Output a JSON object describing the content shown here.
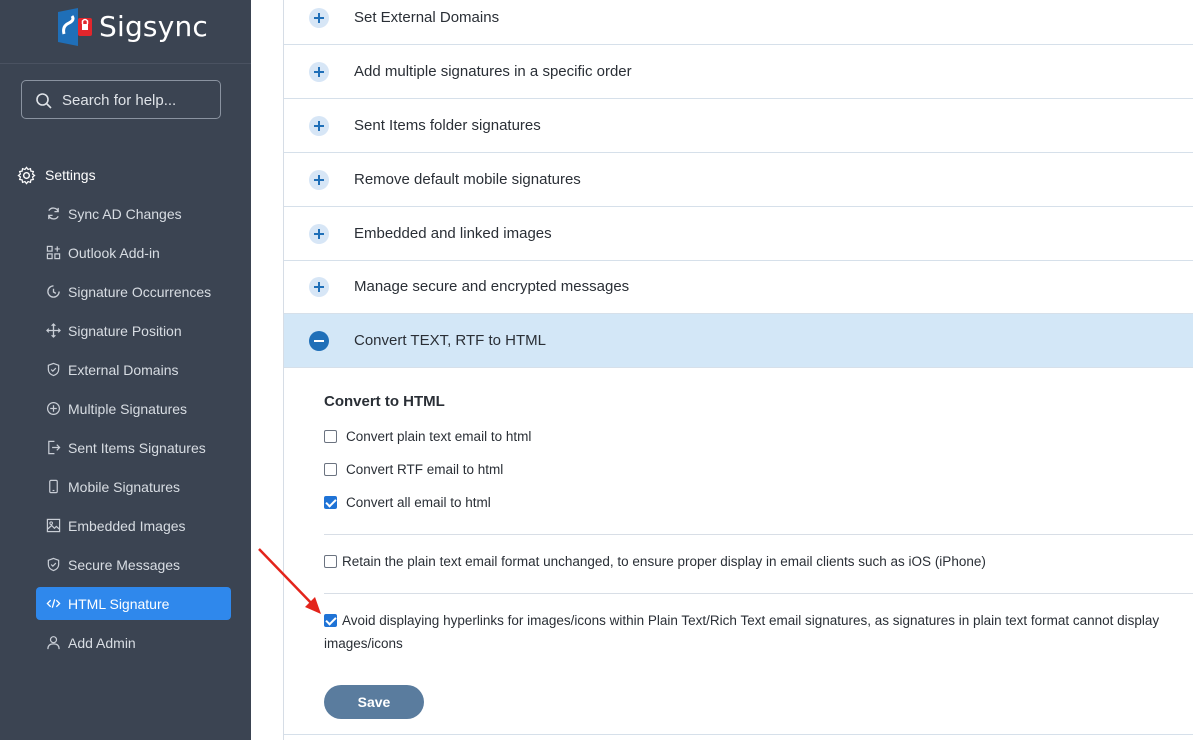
{
  "brand": {
    "name": "Sigsync",
    "colors": {
      "sidebar": "#3b4452",
      "accent": "#2f88ec",
      "logo_red": "#e2262c",
      "logo_blue": "#1f6fb8"
    }
  },
  "search": {
    "placeholder": "Search for help..."
  },
  "sidebar": {
    "section_label": "Settings",
    "items": [
      {
        "label": "Sync AD Changes",
        "icon": "sync-icon"
      },
      {
        "label": "Outlook Add-in",
        "icon": "addin-icon"
      },
      {
        "label": "Signature Occurrences",
        "icon": "occurrence-icon"
      },
      {
        "label": "Signature Position",
        "icon": "move-icon"
      },
      {
        "label": "External Domains",
        "icon": "shield-icon"
      },
      {
        "label": "Multiple Signatures",
        "icon": "plus-circle-icon"
      },
      {
        "label": "Sent Items Signatures",
        "icon": "sent-icon"
      },
      {
        "label": "Mobile Signatures",
        "icon": "mobile-icon"
      },
      {
        "label": "Embedded Images",
        "icon": "image-icon"
      },
      {
        "label": "Secure Messages",
        "icon": "shield-check-icon"
      },
      {
        "label": "HTML Signature",
        "icon": "code-icon",
        "active": true
      },
      {
        "label": "Add Admin",
        "icon": "user-icon"
      }
    ]
  },
  "accordion": [
    {
      "label": "Set External Domains"
    },
    {
      "label": "Add multiple signatures in a specific order"
    },
    {
      "label": "Sent Items folder signatures"
    },
    {
      "label": "Remove default mobile signatures"
    },
    {
      "label": "Embedded and linked images"
    },
    {
      "label": "Manage secure and encrypted messages"
    },
    {
      "label": "Convert TEXT, RTF to HTML",
      "open": true
    }
  ],
  "panel": {
    "title": "Convert to HTML",
    "options": [
      {
        "label": "Convert plain text email to html",
        "checked": false
      },
      {
        "label": "Convert RTF email to html",
        "checked": false
      },
      {
        "label": "Convert all email to html",
        "checked": true
      }
    ],
    "retain": {
      "label": "Retain the plain text email format unchanged, to ensure proper display in email clients such as iOS (iPhone)",
      "checked": false
    },
    "avoid": {
      "label": "Avoid displaying hyperlinks for images/icons within Plain Text/Rich Text email signatures, as signatures in plain text format cannot display images/icons",
      "checked": true
    },
    "save_label": "Save"
  }
}
